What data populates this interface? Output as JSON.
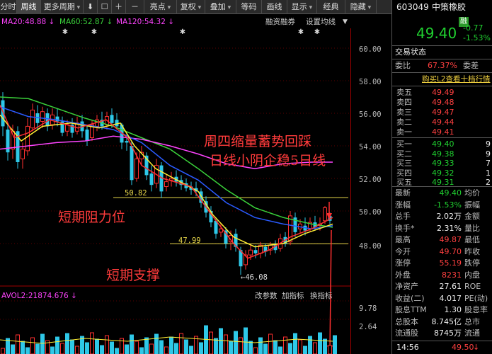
{
  "toolbar": {
    "items": [
      {
        "label": "分时",
        "w": 24
      },
      {
        "label": "周线",
        "w": 34,
        "active": true
      },
      {
        "label": "更多周期",
        "w": 60,
        "dropdown": true
      },
      {
        "label": "⬇",
        "w": 20
      },
      {
        "label": "☐",
        "w": 20
      },
      {
        "label": "＋",
        "w": 20
      },
      {
        "label": "－",
        "w": 26
      },
      {
        "label": "亮点",
        "w": 46,
        "dropdown": true
      },
      {
        "label": "复权",
        "w": 40,
        "dropdown": true
      },
      {
        "label": "叠加",
        "w": 44,
        "dropdown": true
      },
      {
        "label": "等码",
        "w": 36
      },
      {
        "label": "画线",
        "w": 36
      },
      {
        "label": "显示",
        "w": 42,
        "dropdown": true
      },
      {
        "label": "经典",
        "w": 40
      },
      {
        "label": "隐藏",
        "w": 44,
        "dropdown": true
      }
    ]
  },
  "ma_legend": {
    "ma20": "MA20:48.88 ↓",
    "ma60": "MA60:52.87 ↓",
    "ma120": "MA120:54.32 ↓",
    "rzrq": "融资融券",
    "setting": "设置均线",
    "colors": {
      "ma20": "#ff44ff",
      "ma60": "#3ad13a",
      "ma120": "#ff44ff"
    }
  },
  "price_axis": {
    "labels": [
      "60.00",
      "58.00",
      "56.00",
      "54.00",
      "52.00",
      "50.00",
      "48.00"
    ],
    "vol_labels": [
      "9.78",
      "2.64"
    ]
  },
  "annotations": {
    "line1": "周四缩量蓄势回踩",
    "line2": "日线小阴企稳5日线",
    "resistance": "短期阻力位",
    "support": "短期支撑",
    "resistance_level": "50.82",
    "support_level": "47.99",
    "low_mark": "←46.08"
  },
  "volume": {
    "label": "AVOL2:21874.676 ↓",
    "links": [
      "改参数",
      "加指标",
      "换指标"
    ]
  },
  "right_panel": {
    "code": "603049",
    "name": "中策橡胶",
    "badge": "融",
    "price": "49.40",
    "change": "-0.77",
    "change_pct": "-1.53%",
    "trade_status": "交易状态",
    "weibi_label": "委比",
    "weibi_val": "67.37%",
    "weicha_label": "委差",
    "l2_link": "购买L2查看十档行情",
    "asks": [
      {
        "label": "卖五",
        "price": "49.49"
      },
      {
        "label": "卖四",
        "price": "49.48"
      },
      {
        "label": "卖三",
        "price": "49.47"
      },
      {
        "label": "卖二",
        "price": "49.44"
      },
      {
        "label": "卖一",
        "price": "49.41"
      }
    ],
    "bids": [
      {
        "label": "买一",
        "price": "49.40",
        "vol": "9"
      },
      {
        "label": "买二",
        "price": "49.38",
        "vol": "9"
      },
      {
        "label": "买三",
        "price": "49.33",
        "vol": "7"
      },
      {
        "label": "买四",
        "price": "49.32",
        "vol": "1"
      },
      {
        "label": "买五",
        "price": "49.31",
        "vol": "2"
      }
    ],
    "stats": [
      {
        "l1": "最新",
        "v1": "49.40",
        "c1": "grn",
        "l2": "均价"
      },
      {
        "l1": "涨幅",
        "v1": "-1.53%",
        "c1": "grn",
        "l2": "振幅"
      },
      {
        "l1": "总手",
        "v1": "2.02万",
        "c1": "wht",
        "l2": "金额"
      },
      {
        "l1": "换手*",
        "v1": "2.31%",
        "c1": "wht",
        "l2": "量比"
      },
      {
        "l1": "最高",
        "v1": "49.87",
        "c1": "red",
        "l2": "最低"
      },
      {
        "l1": "今开",
        "v1": "49.70",
        "c1": "red",
        "l2": "昨收"
      },
      {
        "l1": "涨停",
        "v1": "55.19",
        "c1": "red",
        "l2": "跌停"
      },
      {
        "l1": "外盘",
        "v1": "8231",
        "c1": "red",
        "l2": "内盘"
      },
      {
        "l1": "净资产",
        "v1": "27.61",
        "c1": "wht",
        "l2": "ROE"
      },
      {
        "l1": "收益(二)",
        "v1": "4.017",
        "c1": "wht",
        "l2": "PE(动)"
      },
      {
        "l1": "股息TTM",
        "v1": "1.30",
        "c1": "wht",
        "l2": "股息率"
      },
      {
        "l1": "总股本",
        "v1": "8.745亿",
        "c1": "wht",
        "l2": "总市"
      },
      {
        "l1": "流通股",
        "v1": "8745万",
        "c1": "wht",
        "l2": "流通"
      }
    ],
    "tick_time": "14:56",
    "tick_price": "49.50",
    "tick_dir": "↓"
  }
}
